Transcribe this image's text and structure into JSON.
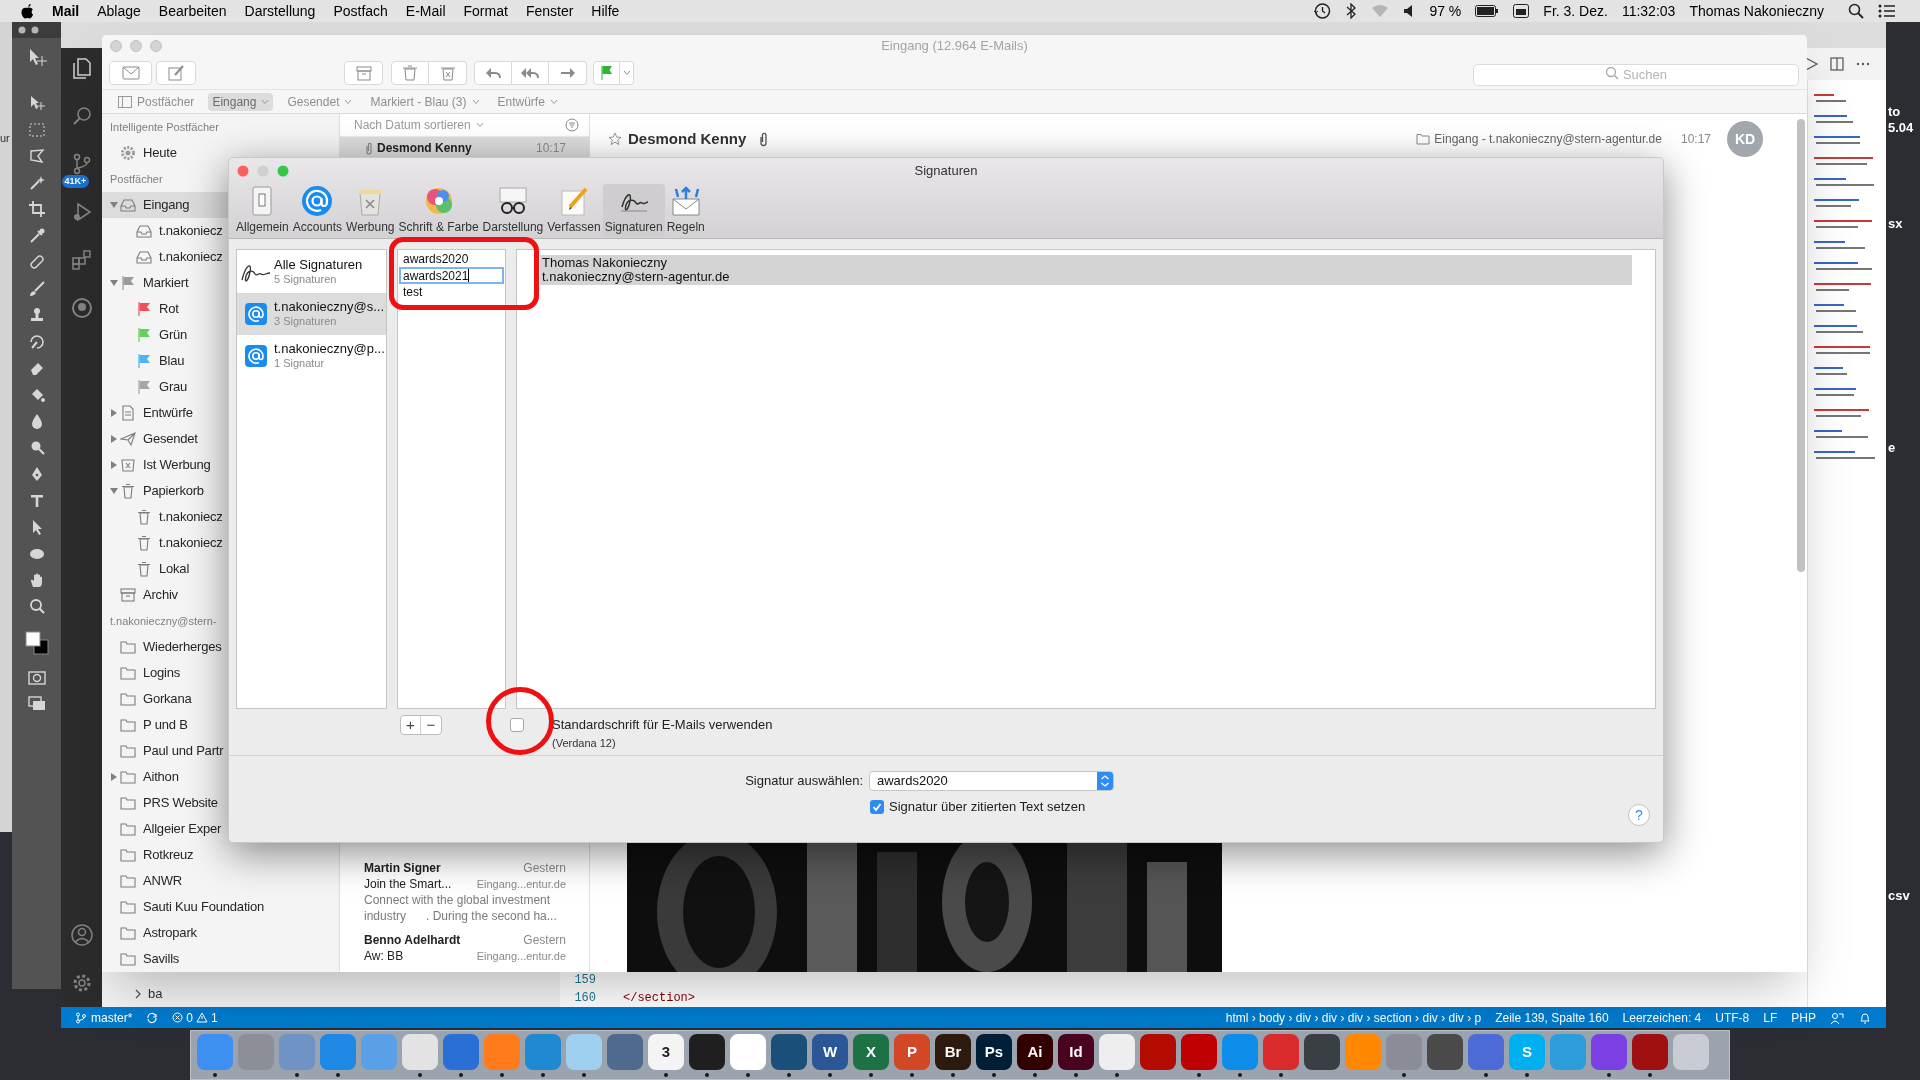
{
  "menu_bar": {
    "app": "Mail",
    "menus": [
      "Ablage",
      "Bearbeiten",
      "Darstellung",
      "Postfach",
      "E-Mail",
      "Format",
      "Fenster",
      "Hilfe"
    ],
    "battery": "97 %",
    "date": "Fr. 3. Dez.",
    "time": "11:32:03",
    "user": "Thomas Nakonieczny"
  },
  "left_window_text": "ur",
  "desktop_labels": [
    "to",
    "5.04",
    "sx",
    "e",
    "csv"
  ],
  "vscode": {
    "scm_badge": "41K+",
    "explorer_item": "ba",
    "lines": [
      {
        "number": "159"
      },
      {
        "number": "160",
        "code": "</section>"
      }
    ],
    "status_bar": {
      "branch": "master*",
      "errors": "0",
      "warnings": "1",
      "breadcrumb": "html › body › div › div › div › section › div › div › p",
      "position": "Zeile 139, Spalte 160",
      "indentation": "Leerzeichen: 4",
      "encoding": "UTF-8",
      "line_ending": "LF",
      "language": "PHP"
    }
  },
  "mail": {
    "title": "Eingang (12.964 E-Mails)",
    "search": {
      "placeholder": "Suchen"
    },
    "favorites": [
      {
        "label": "Postfächer",
        "kind": "toggle",
        "selected": false
      },
      {
        "label": "Eingang",
        "kind": "mailbox",
        "selected": true
      },
      {
        "label": "Gesendet",
        "kind": "mailbox",
        "selected": false
      },
      {
        "label": "Markiert - Blau (3)",
        "kind": "mailbox",
        "selected": false
      },
      {
        "label": "Entwürfe",
        "kind": "mailbox",
        "selected": false
      }
    ],
    "sidebar": [
      {
        "header": "Intelligente Postfächer",
        "items": [
          {
            "label": "Heute",
            "kind": "smart",
            "selected": false
          }
        ]
      },
      {
        "header": "Postfächer",
        "items": [
          {
            "label": "Eingang",
            "kind": "inbox",
            "expanded": true,
            "selected": true,
            "children": [
              {
                "label": "t.nakoniecz",
                "kind": "inbox",
                "selected": false
              },
              {
                "label": "t.nakoniecz",
                "kind": "inbox",
                "selected": false
              }
            ]
          },
          {
            "label": "Markiert",
            "kind": "flag",
            "color": "#9b9b9b",
            "expanded": true,
            "selected": false,
            "children": [
              {
                "label": "Rot",
                "kind": "flag",
                "color": "#f0525a",
                "selected": false
              },
              {
                "label": "Grün",
                "kind": "flag",
                "color": "#62d25a",
                "selected": false
              },
              {
                "label": "Blau",
                "kind": "flag",
                "color": "#4fb3f2",
                "selected": false
              },
              {
                "label": "Grau",
                "kind": "flag",
                "color": "#a6a6a6",
                "selected": false
              }
            ]
          },
          {
            "label": "Entwürfe",
            "kind": "drafts",
            "expanded": false,
            "selected": false
          },
          {
            "label": "Gesendet",
            "kind": "sent",
            "expanded": false,
            "selected": false
          },
          {
            "label": "Ist Werbung",
            "kind": "junk",
            "expanded": false,
            "selected": false
          },
          {
            "label": "Papierkorb",
            "kind": "trash",
            "expanded": true,
            "selected": false,
            "children": [
              {
                "label": "t.nakoniecz",
                "kind": "trash",
                "selected": false
              },
              {
                "label": "t.nakoniecz",
                "kind": "trash",
                "selected": false
              },
              {
                "label": "Lokal",
                "kind": "trash",
                "selected": false
              }
            ]
          },
          {
            "label": "Archiv",
            "kind": "archive",
            "selected": false
          }
        ]
      },
      {
        "header": "t.nakonieczny@stern-",
        "items": [
          {
            "label": "Wiederherges",
            "kind": "folder",
            "selected": false
          },
          {
            "label": "Logins",
            "kind": "folder",
            "selected": false
          },
          {
            "label": "Gorkana",
            "kind": "folder",
            "selected": false
          },
          {
            "label": "P und B",
            "kind": "folder",
            "selected": false
          },
          {
            "label": "Paul und Partr",
            "kind": "folder",
            "selected": false
          },
          {
            "label": "Aithon",
            "kind": "folder",
            "expanded": false,
            "selected": false
          },
          {
            "label": "PRS Website",
            "kind": "folder",
            "selected": false
          },
          {
            "label": "Allgeier Exper",
            "kind": "folder",
            "selected": false
          },
          {
            "label": "Rotkreuz",
            "kind": "folder",
            "selected": false
          },
          {
            "label": "ANWR",
            "kind": "folder",
            "selected": false
          },
          {
            "label": "Sauti Kuu Foundation",
            "kind": "folder",
            "selected": false
          },
          {
            "label": "Astropark",
            "kind": "folder",
            "selected": false
          },
          {
            "label": "Savills",
            "kind": "folder",
            "selected": false
          }
        ]
      }
    ],
    "sort_label": "Nach Datum sortieren",
    "messages": [
      {
        "sender": "Desmond Kenny",
        "time": "10:17",
        "attachment": true,
        "selected": true
      },
      {
        "sender": "Martin Signer",
        "time": "Gestern",
        "subject": "Join the Smart...",
        "mailbox": "Eingang...entur.de",
        "preview": [
          "Connect with the global investment",
          "industry      . During the second ha..."
        ],
        "selected": false
      },
      {
        "sender": "Benno Adelhardt",
        "time": "Gestern",
        "subject": "Aw: BB",
        "mailbox": "Eingang...entur.de",
        "selected": false
      }
    ],
    "viewer": {
      "sender": "Desmond Kenny",
      "starred": false,
      "attachment": true,
      "mailbox": "Eingang - t.nakonieczny@stern-agentur.de",
      "time": "10:17",
      "avatar": "KD",
      "kind": "picture"
    }
  },
  "dialog": {
    "title": "Signaturen",
    "tabs": [
      {
        "label": "Allgemein",
        "kind": "general",
        "selected": false
      },
      {
        "label": "Accounts",
        "kind": "accounts",
        "selected": false
      },
      {
        "label": "Werbung",
        "kind": "junk",
        "selected": false
      },
      {
        "label": "Schrift & Farbe",
        "kind": "fonts",
        "selected": false
      },
      {
        "label": "Darstellung",
        "kind": "viewing",
        "selected": false
      },
      {
        "label": "Verfassen",
        "kind": "composing",
        "selected": false
      },
      {
        "label": "Signaturen",
        "kind": "signatures",
        "selected": true
      },
      {
        "label": "Regeln",
        "kind": "rules",
        "selected": false
      }
    ],
    "accounts": [
      {
        "name": "Alle Signaturen",
        "count": "5 Signaturen",
        "kind": "all",
        "selected": false
      },
      {
        "name": "t.nakonieczny@s...",
        "count": "3 Signaturen",
        "kind": "account",
        "selected": true
      },
      {
        "name": "t.nakonieczny@p...",
        "count": "1 Signatur",
        "kind": "account",
        "selected": false
      }
    ],
    "signatures": [
      {
        "name": "awards2020",
        "editing": false
      },
      {
        "name": "awards2021",
        "editing": true
      },
      {
        "name": "test",
        "editing": false
      }
    ],
    "signature_text": [
      "Thomas Nakonieczny",
      "t.nakonieczny@stern-agentur.de"
    ],
    "add": "+",
    "remove": "−",
    "default_font": {
      "label": "Standardschrift für E-Mails verwenden",
      "font": "(Verdana 12)",
      "checked": false
    },
    "select_label": "Signatur auswählen:",
    "select_value": "awards2020",
    "above_quote": {
      "label": "Signatur über zitierten Text setzen",
      "checked": true
    },
    "help": "?"
  },
  "dock": [
    {
      "color": "#3d8ff0",
      "running": true
    },
    {
      "color": "#8d8f96",
      "running": false
    },
    {
      "color": "#6f93c4",
      "running": true
    },
    {
      "color": "#1e88e5",
      "running": true
    },
    {
      "color": "#5aa0e6",
      "running": false
    },
    {
      "color": "#e3e3e3",
      "running": true
    },
    {
      "color": "#2a6fd6",
      "running": true
    },
    {
      "color": "#ff7b1c",
      "running": true
    },
    {
      "color": "#1f8ad2",
      "running": true
    },
    {
      "color": "#9fd0ef",
      "running": true
    },
    {
      "color": "#4e6a8e",
      "running": false
    },
    {
      "color": "#f4f4f4",
      "glyph": "3",
      "running": true
    },
    {
      "color": "#1f1f1f",
      "running": true
    },
    {
      "color": "#ffffff",
      "running": true
    },
    {
      "color": "#1a4f7a",
      "running": true
    },
    {
      "color": "#2b5797",
      "glyph": "W",
      "running": true
    },
    {
      "color": "#1e7145",
      "glyph": "X",
      "running": true
    },
    {
      "color": "#d24726",
      "glyph": "P",
      "running": true
    },
    {
      "color": "#2b1a0d",
      "glyph": "Br",
      "running": true
    },
    {
      "color": "#001e36",
      "glyph": "Ps",
      "running": true
    },
    {
      "color": "#330000",
      "glyph": "Ai",
      "running": true
    },
    {
      "color": "#49021f",
      "glyph": "Id",
      "running": true
    },
    {
      "color": "#eeeeee",
      "running": true
    },
    {
      "color": "#b30b00",
      "running": false
    },
    {
      "color": "#bf0000",
      "running": true
    },
    {
      "color": "#0e8ee9",
      "running": true
    },
    {
      "color": "#d92b2b",
      "running": true
    },
    {
      "color": "#3a3f44",
      "running": false
    },
    {
      "color": "#ff8800",
      "running": false
    },
    {
      "color": "#8c8c96",
      "running": true
    },
    {
      "color": "#4a4a4a",
      "running": false
    },
    {
      "color": "#4d6bd6",
      "running": true
    },
    {
      "color": "#00aff0",
      "glyph": "S",
      "running": true
    },
    {
      "color": "#2d9cdb",
      "running": false
    },
    {
      "color": "#7b3fe4",
      "running": true
    },
    {
      "color": "#a01010",
      "running": true
    },
    {
      "color": "#c9ccd2",
      "running": false
    }
  ]
}
